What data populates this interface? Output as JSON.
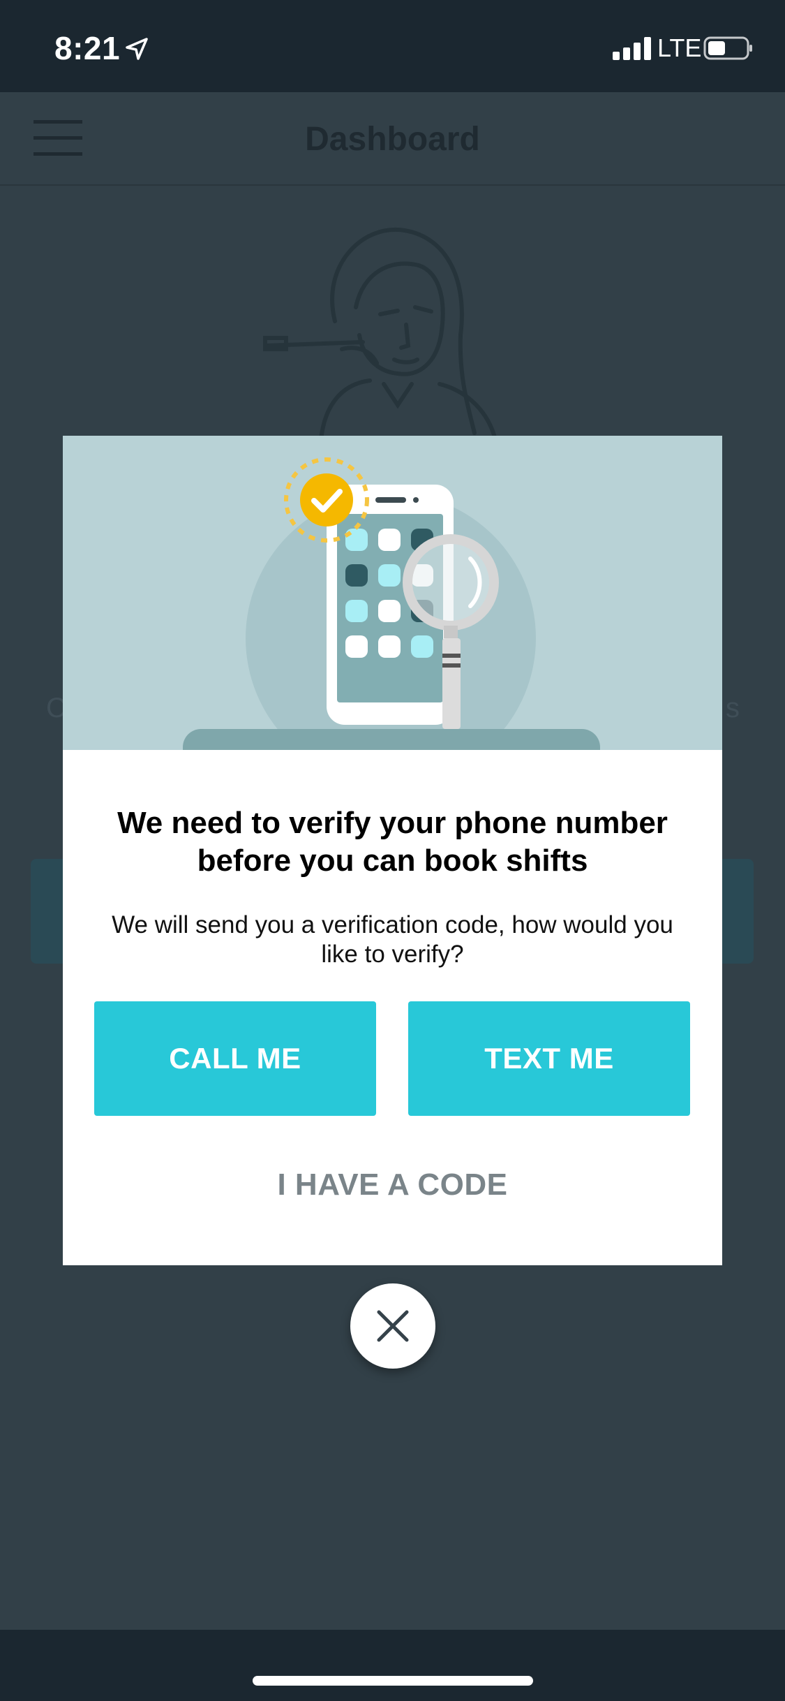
{
  "status_bar": {
    "time": "8:21",
    "network": "LTE",
    "icons": [
      "location-arrow-icon",
      "signal-icon",
      "battery-icon"
    ]
  },
  "header": {
    "title": "Dashboard",
    "menu_icon": "hamburger-menu-icon"
  },
  "modal": {
    "title": "We need to verify your phone number before you can book shifts",
    "message": "We will send you a verification code, how would you like to verify?",
    "call_label": "CALL ME",
    "text_label": "TEXT ME",
    "code_label": "I HAVE A CODE",
    "close_icon": "close-icon"
  },
  "colors": {
    "accent": "#28c8d8",
    "overlay_bg": "#324048",
    "status_bar_bg": "#1b2730",
    "illustration_bg": "#b8d2d6",
    "secondary_text": "#7a8489"
  }
}
